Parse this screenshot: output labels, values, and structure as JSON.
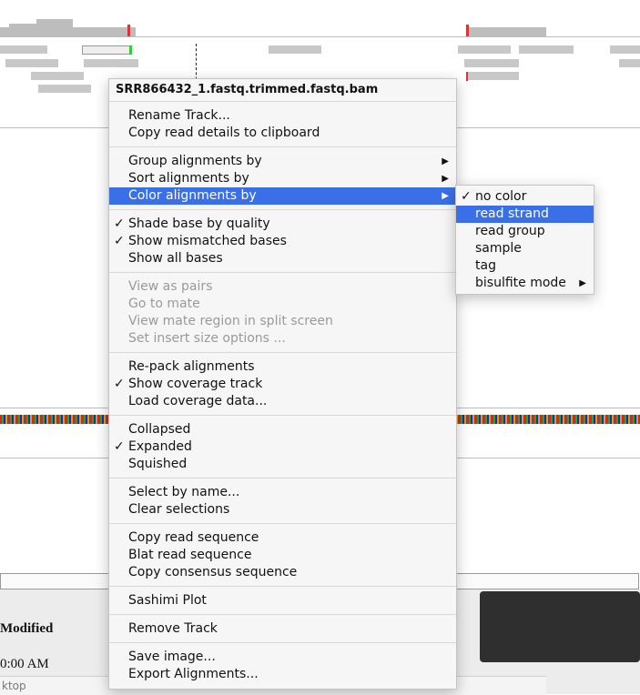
{
  "background": {
    "lower_label_modified": "Modified",
    "lower_label_time": "0:00 AM",
    "bottom_strip_text": "ktop"
  },
  "context_menu": {
    "title": "SRR866432_1.fastq.trimmed.fastq.bam",
    "groups": [
      [
        {
          "label": "Rename Track...",
          "checked": false,
          "enabled": true,
          "submenu": false
        },
        {
          "label": "Copy read details to clipboard",
          "checked": false,
          "enabled": true,
          "submenu": false
        }
      ],
      [
        {
          "label": "Group alignments by",
          "checked": false,
          "enabled": true,
          "submenu": true
        },
        {
          "label": "Sort alignments by",
          "checked": false,
          "enabled": true,
          "submenu": true
        },
        {
          "label": "Color alignments by",
          "checked": false,
          "enabled": true,
          "submenu": true,
          "highlighted": true
        }
      ],
      [
        {
          "label": "Shade base by quality",
          "checked": true,
          "enabled": true,
          "submenu": false
        },
        {
          "label": "Show mismatched bases",
          "checked": true,
          "enabled": true,
          "submenu": false
        },
        {
          "label": "Show all bases",
          "checked": false,
          "enabled": true,
          "submenu": false
        }
      ],
      [
        {
          "label": "View as pairs",
          "checked": false,
          "enabled": false,
          "submenu": false
        },
        {
          "label": "Go to mate",
          "checked": false,
          "enabled": false,
          "submenu": false
        },
        {
          "label": "View mate region in split screen",
          "checked": false,
          "enabled": false,
          "submenu": false
        },
        {
          "label": "Set insert size options ...",
          "checked": false,
          "enabled": false,
          "submenu": false
        }
      ],
      [
        {
          "label": "Re-pack alignments",
          "checked": false,
          "enabled": true,
          "submenu": false
        },
        {
          "label": "Show coverage track",
          "checked": true,
          "enabled": true,
          "submenu": false
        },
        {
          "label": "Load coverage data...",
          "checked": false,
          "enabled": true,
          "submenu": false
        }
      ],
      [
        {
          "label": "Collapsed",
          "checked": false,
          "enabled": true,
          "submenu": false
        },
        {
          "label": "Expanded",
          "checked": true,
          "enabled": true,
          "submenu": false
        },
        {
          "label": "Squished",
          "checked": false,
          "enabled": true,
          "submenu": false
        }
      ],
      [
        {
          "label": "Select by name...",
          "checked": false,
          "enabled": true,
          "submenu": false
        },
        {
          "label": "Clear selections",
          "checked": false,
          "enabled": true,
          "submenu": false
        }
      ],
      [
        {
          "label": "Copy read sequence",
          "checked": false,
          "enabled": true,
          "submenu": false
        },
        {
          "label": "Blat read sequence",
          "checked": false,
          "enabled": true,
          "submenu": false
        },
        {
          "label": "Copy consensus sequence",
          "checked": false,
          "enabled": true,
          "submenu": false
        }
      ],
      [
        {
          "label": "Sashimi Plot",
          "checked": false,
          "enabled": true,
          "submenu": false
        }
      ],
      [
        {
          "label": "Remove Track",
          "checked": false,
          "enabled": true,
          "submenu": false
        }
      ],
      [
        {
          "label": "Save image...",
          "checked": false,
          "enabled": true,
          "submenu": false
        },
        {
          "label": "Export Alignments...",
          "checked": false,
          "enabled": true,
          "submenu": false
        }
      ]
    ]
  },
  "color_submenu": {
    "items": [
      {
        "label": "no color",
        "checked": true,
        "highlighted": false,
        "submenu": false
      },
      {
        "label": "read strand",
        "checked": false,
        "highlighted": true,
        "submenu": false
      },
      {
        "label": "read group",
        "checked": false,
        "highlighted": false,
        "submenu": false
      },
      {
        "label": "sample",
        "checked": false,
        "highlighted": false,
        "submenu": false
      },
      {
        "label": "tag",
        "checked": false,
        "highlighted": false,
        "submenu": false
      },
      {
        "label": "bisulfite mode",
        "checked": false,
        "highlighted": false,
        "submenu": true
      }
    ]
  },
  "glyphs": {
    "check": "✓",
    "arrow": "▶"
  },
  "colors": {
    "highlight": "#3a6fe8",
    "menu_bg": "#f6f6f6"
  }
}
